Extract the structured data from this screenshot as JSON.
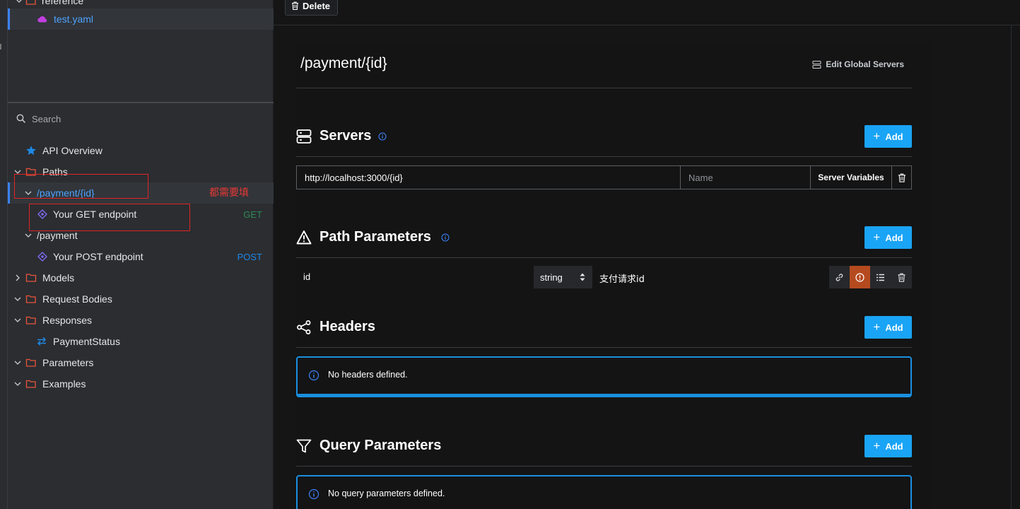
{
  "sidebar": {
    "files": [
      {
        "label": "reference"
      },
      {
        "label": "test.yaml"
      }
    ],
    "search": {
      "placeholder": "Search"
    },
    "tree": [
      {
        "label": "API Overview"
      },
      {
        "label": "Paths"
      },
      {
        "label": "/payment/{id}"
      },
      {
        "label": "Your GET endpoint",
        "method": "GET"
      },
      {
        "label": "/payment"
      },
      {
        "label": "Your POST endpoint",
        "method": "POST"
      },
      {
        "label": "Models"
      },
      {
        "label": "Request Bodies"
      },
      {
        "label": "Responses"
      },
      {
        "label": "PaymentStatus"
      },
      {
        "label": "Parameters"
      },
      {
        "label": "Examples"
      }
    ],
    "annotation_note": "都需要填"
  },
  "toolbar": {
    "delete_label": "Delete"
  },
  "main": {
    "title": "/payment/{id}",
    "edit_global_servers_label": "Edit Global Servers",
    "servers": {
      "title": "Servers",
      "add_label": "Add",
      "rows": [
        {
          "url": "http://localhost:3000/{id}",
          "name_placeholder": "Name",
          "variables_label": "Server Variables"
        }
      ]
    },
    "path_parameters": {
      "title": "Path Parameters",
      "add_label": "Add",
      "rows": [
        {
          "name": "id",
          "type": "string",
          "description": "支付请求id"
        }
      ]
    },
    "headers": {
      "title": "Headers",
      "add_label": "Add",
      "empty_message": "No headers defined."
    },
    "query_parameters": {
      "title": "Query Parameters",
      "add_label": "Add",
      "empty_message": "No query parameters defined."
    }
  },
  "colors": {
    "accent": "#1aa4f5",
    "folder": "#e8553c",
    "link_blue": "#3b82f6",
    "get_method": "#2e8b57",
    "post_method": "#1e88e5",
    "active_action": "#b54a1f",
    "annotation_red": "#e02424"
  },
  "icons": {
    "file": "cloud-icon",
    "overview": "star-icon",
    "folder": "folder-icon",
    "endpoint": "endpoint-diamond-icon",
    "response": "swap-arrows-icon",
    "servers": "server-stack-icon",
    "path_parameters": "warning-triangle-icon",
    "headers": "share-nodes-icon",
    "query_parameters": "filter-funnel-icon"
  }
}
